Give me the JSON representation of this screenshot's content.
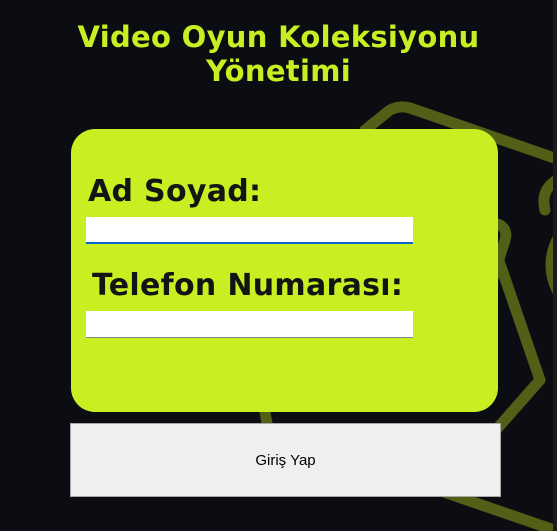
{
  "title_line1": "Video Oyun Koleksiyonu",
  "title_line2": "Yönetimi",
  "form": {
    "name_label": "Ad Soyad:",
    "name_value": "",
    "phone_label": "Telefon Numarası:",
    "phone_value": "",
    "login_button": "Giriş Yap"
  },
  "colors": {
    "accent": "#c8ef21",
    "background": "#0c0d12",
    "decor": "#525f17"
  }
}
